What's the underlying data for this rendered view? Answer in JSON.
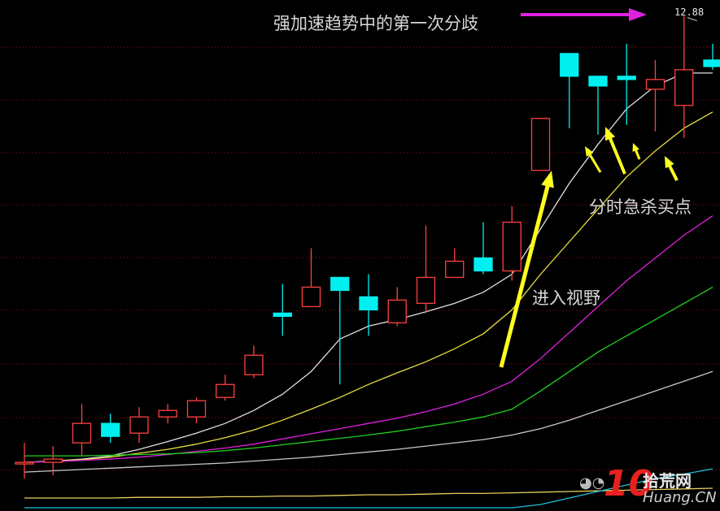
{
  "chart_data": {
    "type": "candlestick",
    "y_high_label": "12.88",
    "grid": "horizontal-dotted",
    "candles": [
      {
        "open": 6.0,
        "close": 6.0,
        "high": 6.3,
        "low": 5.75,
        "color": "red"
      },
      {
        "open": 6.0,
        "close": 6.05,
        "high": 6.25,
        "low": 5.8,
        "color": "red"
      },
      {
        "open": 6.3,
        "close": 6.6,
        "high": 6.9,
        "low": 6.1,
        "color": "red"
      },
      {
        "open": 6.6,
        "close": 6.4,
        "high": 6.75,
        "low": 6.3,
        "color": "cyan"
      },
      {
        "open": 6.45,
        "close": 6.7,
        "high": 6.85,
        "low": 6.3,
        "color": "red"
      },
      {
        "open": 6.7,
        "close": 6.8,
        "high": 6.9,
        "low": 6.6,
        "color": "red"
      },
      {
        "open": 6.7,
        "close": 6.95,
        "high": 7.0,
        "low": 6.6,
        "color": "red"
      },
      {
        "open": 7.0,
        "close": 7.2,
        "high": 7.35,
        "low": 6.95,
        "color": "red"
      },
      {
        "open": 7.35,
        "close": 7.65,
        "high": 7.8,
        "low": 7.3,
        "color": "red"
      },
      {
        "open": 8.3,
        "close": 8.25,
        "high": 8.75,
        "low": 7.95,
        "color": "cyan"
      },
      {
        "open": 8.4,
        "close": 8.7,
        "high": 9.3,
        "low": 8.4,
        "color": "red"
      },
      {
        "open": 8.85,
        "close": 8.65,
        "high": 8.85,
        "low": 7.2,
        "color": "cyan"
      },
      {
        "open": 8.55,
        "close": 8.35,
        "high": 8.9,
        "low": 7.95,
        "color": "cyan"
      },
      {
        "open": 8.15,
        "close": 8.5,
        "high": 8.7,
        "low": 8.1,
        "color": "red"
      },
      {
        "open": 8.45,
        "close": 8.85,
        "high": 9.65,
        "low": 8.3,
        "color": "red"
      },
      {
        "open": 8.85,
        "close": 9.1,
        "high": 9.3,
        "low": 8.9,
        "color": "red"
      },
      {
        "open": 9.15,
        "close": 8.95,
        "high": 9.7,
        "low": 8.9,
        "color": "cyan"
      },
      {
        "open": 8.95,
        "close": 9.7,
        "high": 9.95,
        "low": 8.8,
        "color": "red"
      },
      {
        "open": 10.5,
        "close": 11.3,
        "high": 11.3,
        "low": 10.5,
        "color": "red"
      },
      {
        "open": 12.3,
        "close": 11.95,
        "high": 12.3,
        "low": 11.15,
        "color": "cyan"
      },
      {
        "open": 11.95,
        "close": 11.8,
        "high": 11.9,
        "low": 11.05,
        "color": "cyan"
      },
      {
        "open": 11.95,
        "close": 11.9,
        "high": 12.45,
        "low": 11.2,
        "color": "cyan"
      },
      {
        "open": 11.75,
        "close": 11.9,
        "high": 12.2,
        "low": 11.1,
        "color": "red"
      },
      {
        "open": 11.5,
        "close": 12.05,
        "high": 12.88,
        "low": 11.0,
        "color": "red"
      },
      {
        "open": 12.2,
        "close": 12.1,
        "high": 12.45,
        "low": 12.05,
        "color": "cyan"
      }
    ],
    "moving_averages": [
      {
        "color": "#e0e0e0",
        "values": [
          6.0,
          6.02,
          6.05,
          6.1,
          6.2,
          6.32,
          6.45,
          6.6,
          6.8,
          7.05,
          7.4,
          7.9,
          8.1,
          8.2,
          8.32,
          8.45,
          8.62,
          8.9,
          9.6,
          10.3,
          10.9,
          11.45,
          11.8,
          12.0,
          12.0
        ]
      },
      {
        "color": "#e8e040",
        "values": [
          6.0,
          6.02,
          6.04,
          6.08,
          6.14,
          6.2,
          6.28,
          6.38,
          6.5,
          6.65,
          6.82,
          7.0,
          7.2,
          7.38,
          7.55,
          7.75,
          7.98,
          8.35,
          8.9,
          9.4,
          9.9,
          10.4,
          10.8,
          11.15,
          11.4
        ]
      },
      {
        "color": "#e020e0",
        "values": [
          6.0,
          6.01,
          6.03,
          6.05,
          6.08,
          6.12,
          6.17,
          6.22,
          6.28,
          6.36,
          6.44,
          6.52,
          6.6,
          6.68,
          6.78,
          6.9,
          7.05,
          7.25,
          7.6,
          8.0,
          8.4,
          8.8,
          9.15,
          9.5,
          9.8
        ]
      },
      {
        "color": "#20d020",
        "values": [
          6.1,
          6.1,
          6.1,
          6.11,
          6.12,
          6.13,
          6.15,
          6.18,
          6.22,
          6.27,
          6.32,
          6.37,
          6.42,
          6.48,
          6.55,
          6.62,
          6.7,
          6.82,
          7.1,
          7.4,
          7.7,
          7.95,
          8.2,
          8.45,
          8.7
        ]
      },
      {
        "color": "#c8c8c8",
        "values": [
          5.85,
          5.87,
          5.89,
          5.91,
          5.93,
          5.95,
          5.97,
          5.99,
          6.02,
          6.05,
          6.08,
          6.12,
          6.16,
          6.2,
          6.25,
          6.3,
          6.35,
          6.42,
          6.52,
          6.65,
          6.8,
          6.95,
          7.1,
          7.25,
          7.4
        ]
      },
      {
        "color": "#e8d060",
        "values": [
          5.45,
          5.45,
          5.45,
          5.45,
          5.46,
          5.46,
          5.46,
          5.47,
          5.47,
          5.48,
          5.48,
          5.49,
          5.5,
          5.5,
          5.51,
          5.52,
          5.52,
          5.53,
          5.54,
          5.55,
          5.56,
          5.57,
          5.58,
          5.59,
          5.6
        ]
      },
      {
        "color": "#20c0e0",
        "values": [
          5.3,
          5.3,
          5.3,
          5.3,
          5.3,
          5.3,
          5.3,
          5.3,
          5.3,
          5.3,
          5.3,
          5.3,
          5.3,
          5.3,
          5.3,
          5.3,
          5.3,
          5.3,
          5.35,
          5.45,
          5.55,
          5.65,
          5.75,
          5.82,
          5.9
        ]
      }
    ],
    "ylim": [
      5.3,
      13.0
    ]
  },
  "annotations": {
    "title": "强加速趋势中的第一次分歧",
    "dip_buy": "分时急杀买点",
    "enter_view": "进入视野"
  },
  "watermark": {
    "number": "10",
    "text": "拾荒网",
    "site": "Huang.CN"
  },
  "colors": {
    "up": "#ff4040",
    "down": "#00f0f0",
    "arrow_yellow": "#ffff20",
    "arrow_magenta": "#e020e0"
  }
}
